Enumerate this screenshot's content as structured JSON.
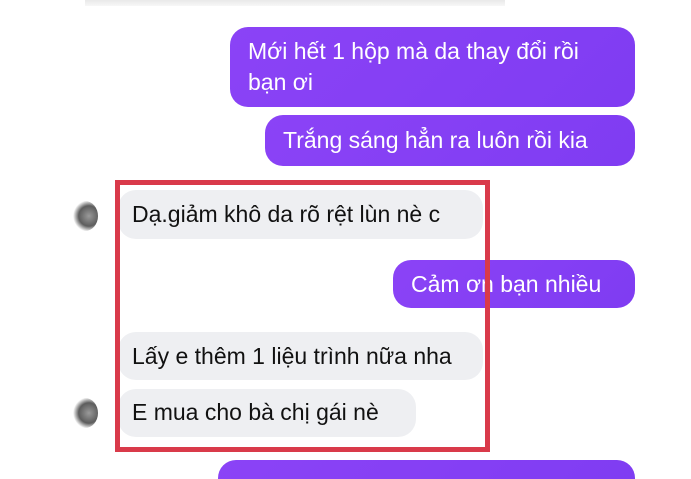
{
  "chat": {
    "messages": [
      {
        "direction": "outgoing",
        "line1": "Mới hết 1 hộp mà da thay đổi rồi",
        "line2": "bạn ơi"
      },
      {
        "direction": "outgoing",
        "text": "Trắng sáng hẳn ra luôn rồi kia"
      },
      {
        "direction": "incoming",
        "text": "Dạ.giảm khô da rõ rệt lùn nè c"
      },
      {
        "direction": "outgoing",
        "text": "Cảm ơn bạn nhiều"
      },
      {
        "direction": "incoming",
        "text": "Lấy e thêm 1 liệu trình nữa nha"
      },
      {
        "direction": "incoming",
        "text": "E mua cho bà chị gái nè"
      },
      {
        "direction": "outgoing",
        "text": ""
      }
    ]
  },
  "colors": {
    "outgoing_bubble": "#8a3ffc",
    "incoming_bubble": "#eeeff2",
    "highlight_border": "#d93a4a"
  },
  "icons": {
    "contact_avatar": "avatar"
  }
}
